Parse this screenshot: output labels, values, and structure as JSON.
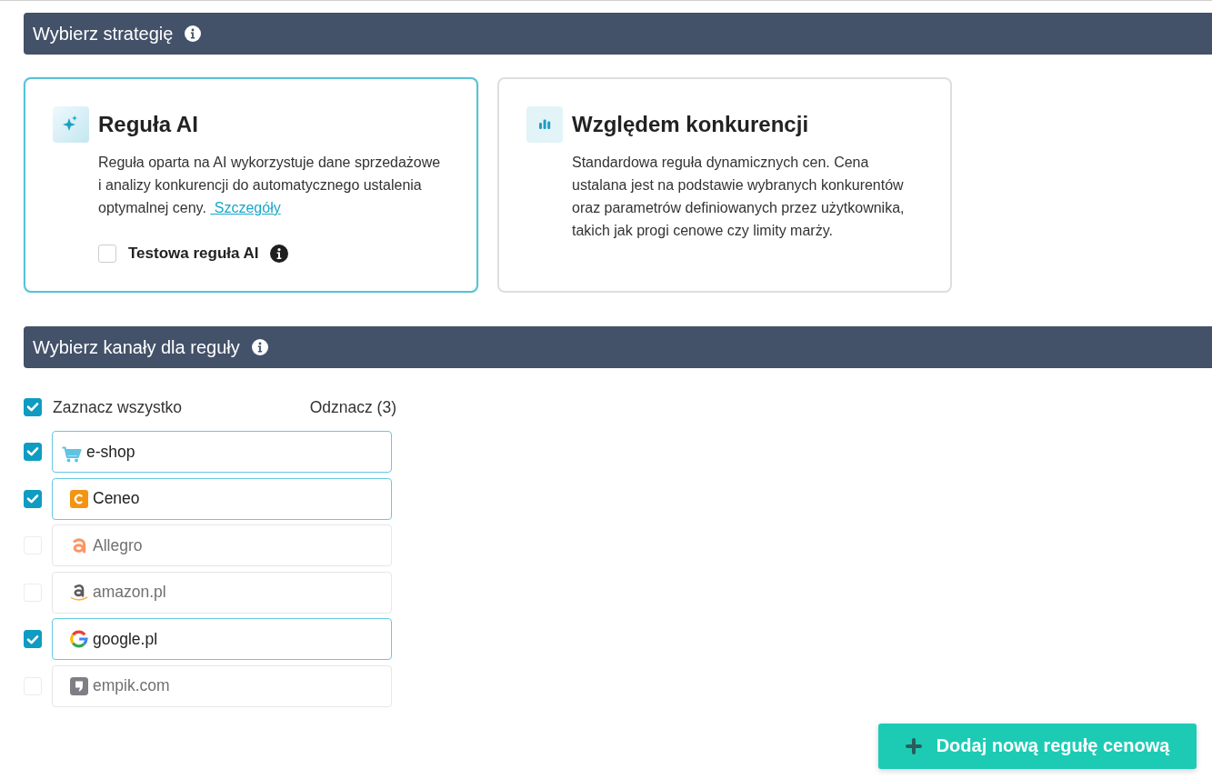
{
  "strategy_section": {
    "title": "Wybierz strategię",
    "options": [
      {
        "kind": "ai",
        "title": "Reguła AI",
        "description": "Reguła oparta na AI wykorzystuje dane sprzedażowe i analizy konkurencji do automatycznego ustalenia optymalnej ceny.",
        "link": "Szczegóły",
        "selected": true,
        "test_option": {
          "label": "Testowa reguła AI",
          "checked": false
        }
      },
      {
        "kind": "competition",
        "title": "Względem konkurencji",
        "description": "Standardowa reguła dynamicznych cen. Cena ustalana jest na podstawie wybranych konkurentów oraz parametrów definiowanych przez użytkownika, takich jak progi cenowe czy limity marży.",
        "selected": false
      }
    ]
  },
  "channels_section": {
    "title": "Wybierz kanały dla reguły",
    "select_all": {
      "label": "Zaznacz wszystko",
      "checked": true
    },
    "deselect_label": "Odznacz (3)",
    "channels": [
      {
        "kind": "eshop",
        "name": "e-shop",
        "checked": true
      },
      {
        "kind": "ceneo",
        "name": "Ceneo",
        "checked": true
      },
      {
        "kind": "allegro",
        "name": "Allegro",
        "checked": false
      },
      {
        "kind": "amazon",
        "name": "amazon.pl",
        "checked": false
      },
      {
        "kind": "google",
        "name": "google.pl",
        "checked": true
      },
      {
        "kind": "empik",
        "name": "empik.com",
        "checked": false
      }
    ]
  },
  "add_button": "Dodaj nową regułę cenową"
}
